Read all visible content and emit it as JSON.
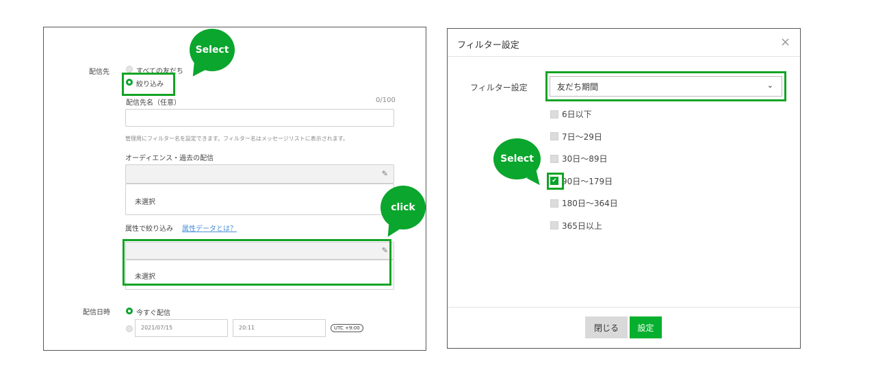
{
  "left": {
    "bubble_select": "Select",
    "bubble_click": "click",
    "section_recipients_label": "配信先",
    "radio_all_label": "すべての友だち",
    "radio_narrow_label": "絞り込み",
    "dest_name_label": "配信先名（任意）",
    "dest_name_counter": "0/100",
    "dest_name_help": "管理用にフィルター名を設定できます。フィルター名はメッセージリストに表示されます。",
    "audience_label": "オーディエンス・過去の配信",
    "audience_value": "未選択",
    "attribute_label": "属性で絞り込み",
    "attribute_link": "属性データとは？",
    "attribute_value": "未選択",
    "schedule_label": "配信日時",
    "radio_now_label": "今すぐ配信",
    "date_value": "2021/07/15",
    "time_value": "20:11",
    "utc_badge": "UTC +9:00"
  },
  "dialog": {
    "title": "フィルター設定",
    "close_icon": "×",
    "filter_label": "フィルター設定",
    "select_value": "友だち期間",
    "select_chevron": "⌄",
    "bubble_select": "Select",
    "options": [
      {
        "label": "6日以下",
        "checked": false
      },
      {
        "label": "7日〜29日",
        "checked": false
      },
      {
        "label": "30日〜89日",
        "checked": false
      },
      {
        "label": "90日〜179日",
        "checked": true
      },
      {
        "label": "180日〜364日",
        "checked": false
      },
      {
        "label": "365日以上",
        "checked": false
      }
    ],
    "close_button": "閉じる",
    "ok_button": "設定"
  },
  "colors": {
    "accent_green": "#06a32b",
    "bubble_green": "#0aa62d"
  }
}
